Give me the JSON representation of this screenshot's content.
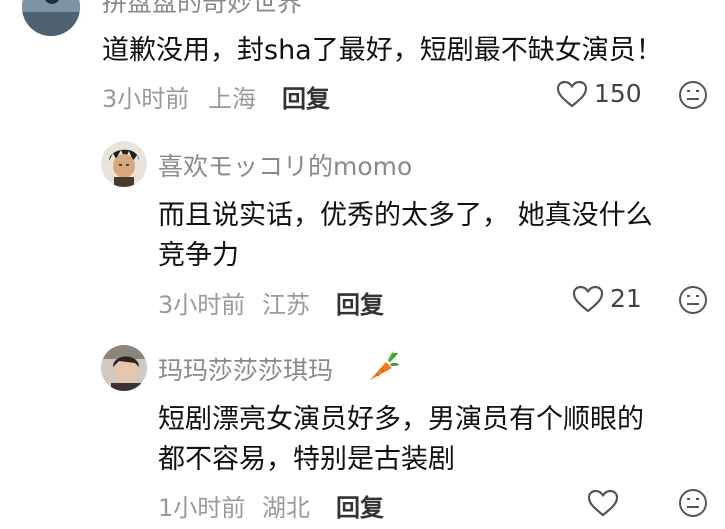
{
  "comments": [
    {
      "username": "拼盘盘的奇妙世界",
      "text_lines": [
        "道歉没用，封sha了最好，短剧最不缺女演员！"
      ],
      "time": "3小时前",
      "location": "上海",
      "reply_label": "回复",
      "likes": "150"
    },
    {
      "username": "喜欢モッコリ的momo",
      "text_lines": [
        "而且说实话，优秀的太多了， 她真没什么",
        "竞争力"
      ],
      "time": "3小时前",
      "location": "江苏",
      "reply_label": "回复",
      "likes": "21"
    },
    {
      "username": "玛玛莎莎莎琪玛",
      "text_lines": [
        "短剧漂亮女演员好多，男演员有个顺眼的",
        "都不容易，特别是古装剧"
      ],
      "time": "1小时前",
      "location": "湖北",
      "reply_label": "回复",
      "likes": ""
    }
  ],
  "icons": {
    "like": "heart-outline-icon",
    "dislike": "meh-face-icon",
    "carrot": "carrot-emoji-icon"
  },
  "colors": {
    "username": "#8a8a8a",
    "meta": "#9a9a9a",
    "text": "#111111",
    "carrot": "#f07a1a"
  }
}
